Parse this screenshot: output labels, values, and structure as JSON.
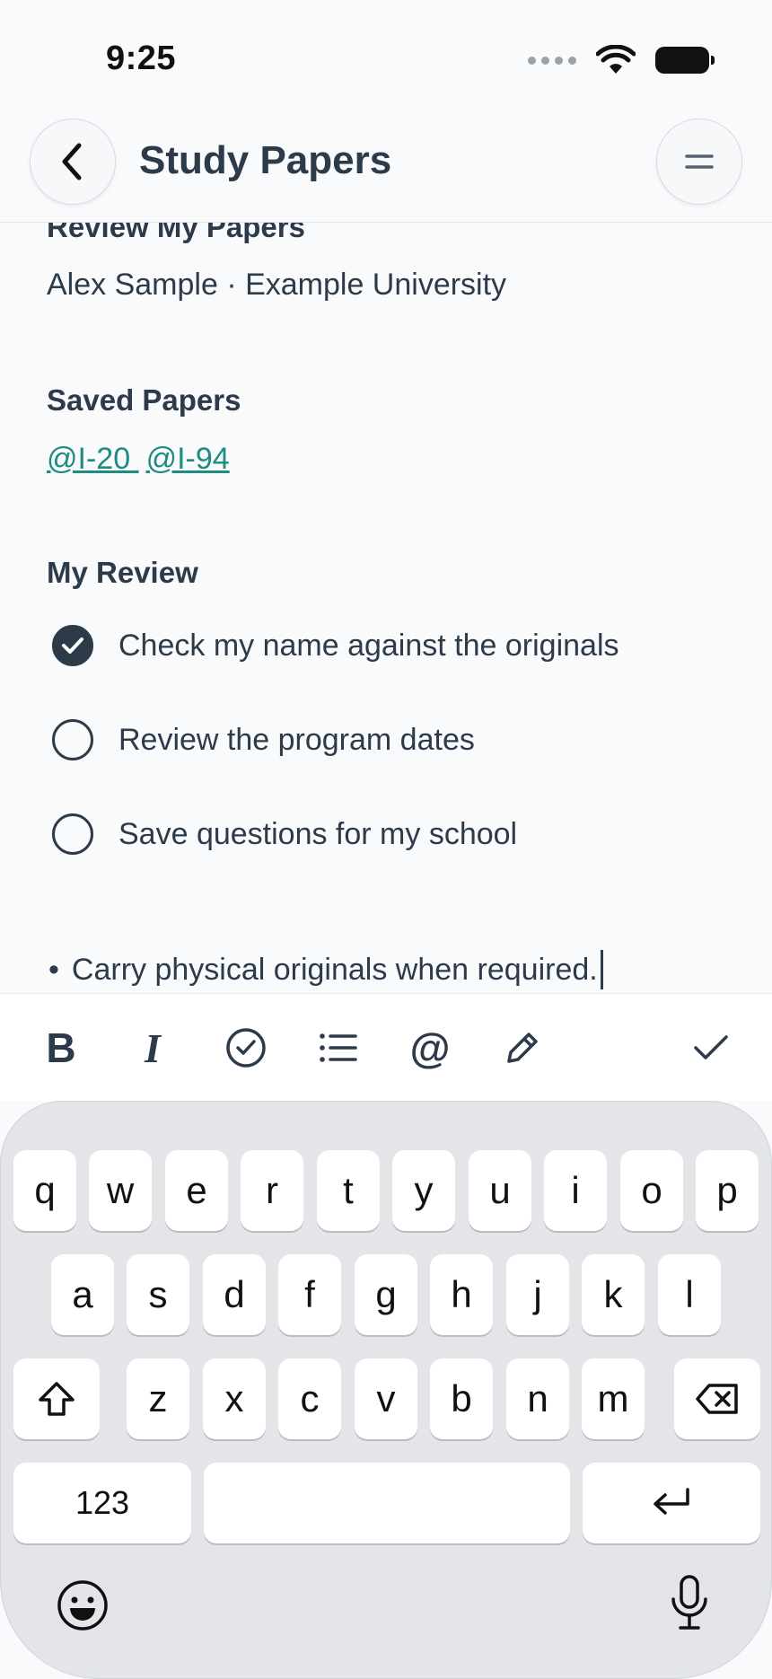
{
  "status_bar": {
    "time": "9:25"
  },
  "nav": {
    "title": "Study Papers"
  },
  "content": {
    "partial_heading": "Review My Papers",
    "owner_line": "Alex Sample · Example University",
    "saved_heading": "Saved Papers",
    "saved_links": [
      "@I-20",
      "@I-94"
    ],
    "review_heading": "My Review",
    "checklist": [
      {
        "label": "Check my name against the originals",
        "checked": true
      },
      {
        "label": "Review the program dates",
        "checked": false
      },
      {
        "label": "Save questions for my school",
        "checked": false
      }
    ],
    "bullet": "•",
    "bullet_text": "Carry physical originals when required."
  },
  "toolbar": {
    "bold_label": "B",
    "italic_label": "I",
    "mention_label": "@"
  },
  "keyboard": {
    "row1": [
      "q",
      "w",
      "e",
      "r",
      "t",
      "y",
      "u",
      "i",
      "o",
      "p"
    ],
    "row2": [
      "a",
      "s",
      "d",
      "f",
      "g",
      "h",
      "j",
      "k",
      "l"
    ],
    "row3": [
      "z",
      "x",
      "c",
      "v",
      "b",
      "n",
      "m"
    ],
    "numbers_label": "123"
  }
}
